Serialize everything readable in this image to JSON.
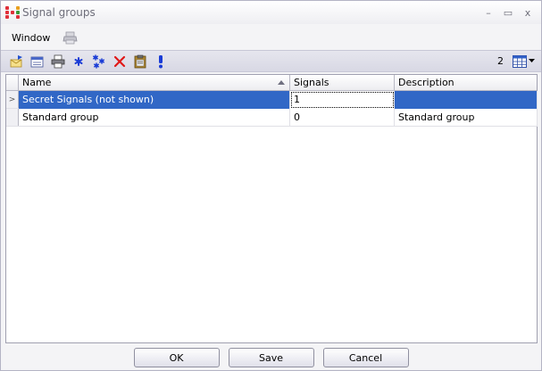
{
  "window": {
    "title": "Signal groups",
    "minimize": "–",
    "maximize": "▭",
    "close": "x"
  },
  "menu": {
    "window_label": "Window",
    "print_icon": "printer-icon"
  },
  "toolbar": {
    "buttons": [
      {
        "icon": "new-item-icon"
      },
      {
        "icon": "edit-icon"
      },
      {
        "icon": "print-icon"
      },
      {
        "icon": "asterisk-icon"
      },
      {
        "icon": "multi-asterisk-icon"
      },
      {
        "icon": "delete-icon"
      },
      {
        "icon": "clipboard-icon"
      },
      {
        "icon": "exclamation-icon"
      }
    ],
    "count": "2",
    "layout_icon": "grid-layout-icon"
  },
  "grid": {
    "columns": [
      "Name",
      "Signals",
      "Description"
    ],
    "sorted_column": "Name",
    "rows": [
      {
        "name": "Secret Signals (not shown)",
        "signals": "1",
        "description": "",
        "selected": true,
        "current": true
      },
      {
        "name": "Standard group",
        "signals": "0",
        "description": "Standard group",
        "selected": false,
        "current": false
      }
    ]
  },
  "buttons": {
    "ok": "OK",
    "save": "Save",
    "cancel": "Cancel"
  },
  "colors": {
    "selection": "#3167c6",
    "accent_blue": "#1a3cd6",
    "delete_red": "#e01818"
  }
}
